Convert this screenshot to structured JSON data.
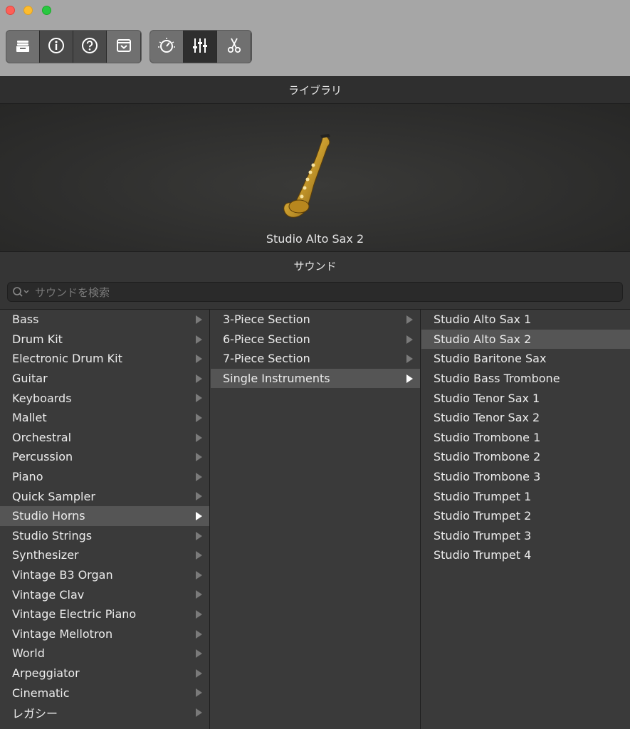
{
  "library": {
    "header": "ライブラリ",
    "preview_name": "Studio Alto Sax 2"
  },
  "sound": {
    "header": "サウンド",
    "search_placeholder": "サウンドを検索"
  },
  "toolbar": {
    "group1": [
      "library-icon",
      "info-icon",
      "help-icon",
      "editors-icon"
    ],
    "group2": [
      "smart-controls-icon",
      "mixer-icon",
      "scissors-icon"
    ]
  },
  "categories": [
    {
      "label": "Bass"
    },
    {
      "label": "Drum Kit"
    },
    {
      "label": "Electronic Drum Kit"
    },
    {
      "label": "Guitar"
    },
    {
      "label": "Keyboards"
    },
    {
      "label": "Mallet"
    },
    {
      "label": "Orchestral"
    },
    {
      "label": "Percussion"
    },
    {
      "label": "Piano"
    },
    {
      "label": "Quick Sampler"
    },
    {
      "label": "Studio Horns"
    },
    {
      "label": "Studio Strings"
    },
    {
      "label": "Synthesizer"
    },
    {
      "label": "Vintage B3 Organ"
    },
    {
      "label": "Vintage Clav"
    },
    {
      "label": "Vintage Electric Piano"
    },
    {
      "label": "Vintage Mellotron"
    },
    {
      "label": "World"
    },
    {
      "label": "Arpeggiator"
    },
    {
      "label": "Cinematic"
    },
    {
      "label": "レガシー"
    }
  ],
  "subcategories": [
    {
      "label": "3-Piece Section"
    },
    {
      "label": "6-Piece Section"
    },
    {
      "label": "7-Piece Section"
    },
    {
      "label": "Single Instruments"
    }
  ],
  "patches": [
    {
      "label": "Studio Alto Sax 1"
    },
    {
      "label": "Studio Alto Sax 2"
    },
    {
      "label": "Studio Baritone Sax"
    },
    {
      "label": "Studio Bass Trombone"
    },
    {
      "label": "Studio Tenor Sax 1"
    },
    {
      "label": "Studio Tenor Sax 2"
    },
    {
      "label": "Studio Trombone 1"
    },
    {
      "label": "Studio Trombone 2"
    },
    {
      "label": "Studio Trombone 3"
    },
    {
      "label": "Studio Trumpet 1"
    },
    {
      "label": "Studio Trumpet 2"
    },
    {
      "label": "Studio Trumpet 3"
    },
    {
      "label": "Studio Trumpet 4"
    }
  ],
  "selected": {
    "category": "Studio Horns",
    "subcategory": "Single Instruments",
    "patch": "Studio Alto Sax 2"
  }
}
